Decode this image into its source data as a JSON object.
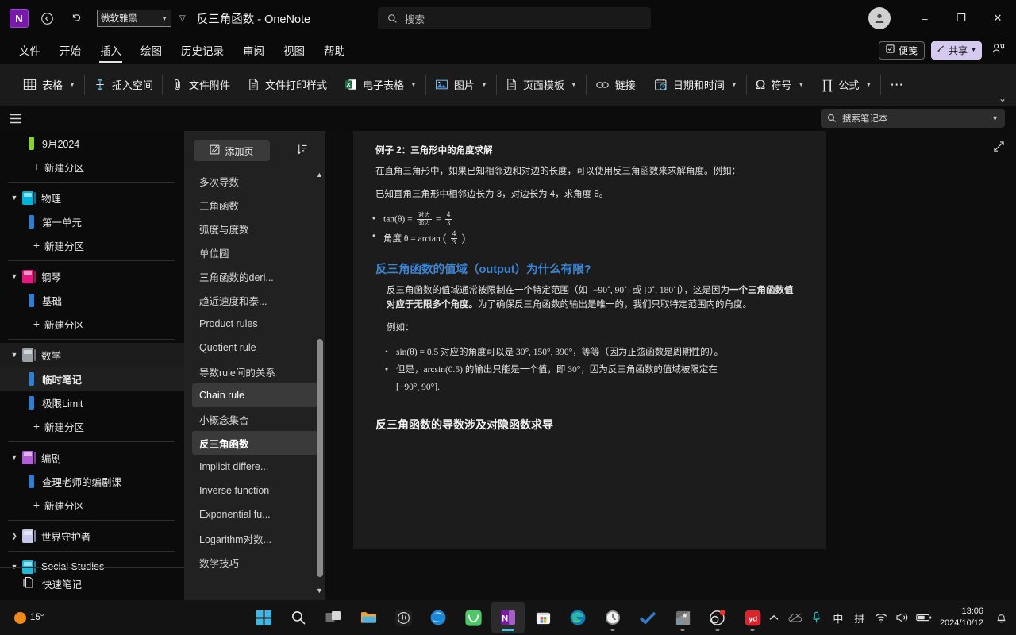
{
  "titlebar": {
    "app_logo": "N",
    "back_icon": "back-arrow-icon",
    "undo_icon": "undo-icon",
    "font_name": "微软雅黑",
    "doc_title": "反三角函数 - OneNote",
    "search_placeholder": "搜索",
    "minimize": "–",
    "maximize": "❐",
    "close": "✕"
  },
  "menu": {
    "items": [
      {
        "label": "文件",
        "active": false
      },
      {
        "label": "开始",
        "active": false
      },
      {
        "label": "插入",
        "active": true
      },
      {
        "label": "绘图",
        "active": false
      },
      {
        "label": "历史记录",
        "active": false
      },
      {
        "label": "审阅",
        "active": false
      },
      {
        "label": "视图",
        "active": false
      },
      {
        "label": "帮助",
        "active": false
      }
    ],
    "sticky_notes": "便笺",
    "share": "共享"
  },
  "ribbon": {
    "groups": [
      {
        "label": "表格",
        "icon": "table-icon",
        "dropdown": true
      },
      {
        "label": "插入空间",
        "icon": "insert-space-icon",
        "dropdown": false
      },
      {
        "label": "文件附件",
        "icon": "paperclip-icon",
        "dropdown": false
      },
      {
        "label": "文件打印样式",
        "icon": "printout-icon",
        "dropdown": false
      },
      {
        "label": "电子表格",
        "icon": "excel-icon",
        "dropdown": true
      },
      {
        "label": "图片",
        "icon": "picture-icon",
        "dropdown": true
      },
      {
        "label": "页面模板",
        "icon": "page-template-icon",
        "dropdown": true
      },
      {
        "label": "链接",
        "icon": "link-icon",
        "dropdown": false
      },
      {
        "label": "日期和时间",
        "icon": "calendar-clock-icon",
        "dropdown": true
      },
      {
        "label": "符号",
        "icon": "omega-icon",
        "dropdown": true
      },
      {
        "label": "公式",
        "icon": "pi-icon",
        "dropdown": true
      }
    ],
    "overflow": "⋯",
    "collapse": "⌄"
  },
  "notebookbar": {
    "menu_icon": "hamburger-icon",
    "search_placeholder": "搜索笔记本"
  },
  "leftnav": {
    "items": [
      {
        "type": "section",
        "label": "9月2024",
        "color": "#8bd02b"
      },
      {
        "type": "new",
        "label": "新建分区"
      },
      {
        "type": "divider"
      },
      {
        "type": "notebook",
        "label": "物理",
        "color": "#00b3d8",
        "expanded": true
      },
      {
        "type": "section",
        "label": "第一单元",
        "color": "#2f7fd1"
      },
      {
        "type": "new",
        "label": "新建分区"
      },
      {
        "type": "divider"
      },
      {
        "type": "notebook",
        "label": "钢琴",
        "color": "#e6187f",
        "expanded": true
      },
      {
        "type": "section",
        "label": "基础",
        "color": "#2f7fd1"
      },
      {
        "type": "new",
        "label": "新建分区"
      },
      {
        "type": "divider"
      },
      {
        "type": "notebook",
        "label": "数学",
        "color": "#9aa0a6",
        "expanded": true,
        "selected": true
      },
      {
        "type": "section",
        "label": "临时笔记",
        "color": "#2f7fd1",
        "current": true
      },
      {
        "type": "section",
        "label": "极限Limit",
        "color": "#2f7fd1"
      },
      {
        "type": "new",
        "label": "新建分区"
      },
      {
        "type": "divider"
      },
      {
        "type": "notebook",
        "label": "编剧",
        "color": "#b35fd6",
        "expanded": true
      },
      {
        "type": "section",
        "label": "查理老师的编剧课",
        "color": "#2f7fd1"
      },
      {
        "type": "new",
        "label": "新建分区"
      },
      {
        "type": "divider"
      },
      {
        "type": "notebook",
        "label": "世界守护者",
        "color": "#c5c8e8",
        "expanded": false
      },
      {
        "type": "divider"
      },
      {
        "type": "notebook",
        "label": "Social Studies",
        "color": "#22b8d6",
        "expanded": true
      }
    ],
    "quick_notes": "快速笔记"
  },
  "pagelist": {
    "add_page": "添加页",
    "add_page_icon": "new-page-icon",
    "sort_icon": "sort-icon",
    "pages": [
      {
        "label": "多次导数"
      },
      {
        "label": "三角函数"
      },
      {
        "label": "弧度与度数"
      },
      {
        "label": "单位圆"
      },
      {
        "label": "三角函数的deri..."
      },
      {
        "label": "趋近速度和泰..."
      },
      {
        "label": "Product rules"
      },
      {
        "label": "Quotient rule"
      },
      {
        "label": "导数rule间的关系"
      },
      {
        "label": "Chain rule",
        "hover": true
      },
      {
        "label": "小概念集合"
      },
      {
        "label": "反三角函数",
        "current": true
      },
      {
        "label": "Implicit differe..."
      },
      {
        "label": "Inverse function"
      },
      {
        "label": "Exponential fu..."
      },
      {
        "label": "Logarithm对数..."
      },
      {
        "label": "数学技巧"
      }
    ],
    "nav_toggle_icon": "page-nav-toggle-icon",
    "nav_toggle_label": "+"
  },
  "canvas": {
    "expand_icon": "expand-icon",
    "example_title": "例子 2：三角形中的角度求解",
    "para1": "在直角三角形中，如果已知相邻边和对边的长度，可以使用反三角函数来求解角度。例如：",
    "para2": "已知直角三角形中相邻边长为 3，对边长为 4，求角度 θ。",
    "bullet1_prefix": "tan(θ) =",
    "bullet1_frac1_num": "对边",
    "bullet1_frac1_den": "邻边",
    "bullet1_eq": "=",
    "bullet1_frac2_num": "4",
    "bullet1_frac2_den": "3",
    "bullet2_prefix": "角度 θ = arctan",
    "bullet2_frac_num": "4",
    "bullet2_frac_den": "3",
    "heading_blue": "反三角函数的值域（output）为什么有限?",
    "para3_a": "反三角函数的值域通常被限制在一个特定范围（如 ",
    "para3_range1": "[−90˚, 90˚]",
    "para3_b": " 或 ",
    "para3_range2": "[0˚, 180˚]",
    "para3_c": "），这是因为",
    "para3_bold": "一个三角函数值对应于无限多个角度。",
    "para3_d": "为了确保反三角函数的输出是唯一的，我们只取特定范围内的角度。",
    "para4": "例如：",
    "bullet3": "sin(θ) = 0.5 对应的角度可以是 30°, 150°, 390°，等等（因为正弦函数是周期性的）。",
    "bullet4_a": "但是，arcsin(0.5) 的输出只能是一个值，即 30°，因为反三角函数的值域被限定在",
    "bullet4_b": "[−90°, 90°].",
    "heading_white": "反三角函数的导数涉及对隐函数求导"
  },
  "taskbar": {
    "weather_temp": "15°",
    "weather_icon": "sun-cloud-icon",
    "buttons": [
      {
        "name": "start-button",
        "icon": "windows-logo-icon"
      },
      {
        "name": "search-button",
        "icon": "search-icon"
      },
      {
        "name": "task-view-button",
        "icon": "task-view-icon"
      },
      {
        "name": "file-explorer-button",
        "icon": "folder-icon"
      },
      {
        "name": "app-unreal-button",
        "icon": "unreal-icon"
      },
      {
        "name": "app-browser-button",
        "icon": "browser-icon"
      },
      {
        "name": "app-chat-button",
        "icon": "green-chat-icon"
      },
      {
        "name": "onenote-button",
        "icon": "onenote-icon",
        "active": true
      },
      {
        "name": "microsoft-store-button",
        "icon": "store-icon"
      },
      {
        "name": "edge-button",
        "icon": "edge-icon"
      },
      {
        "name": "clock-app-button",
        "icon": "clock-icon"
      },
      {
        "name": "todo-button",
        "icon": "checkmark-icon"
      },
      {
        "name": "snipping-tool-button",
        "icon": "snip-icon"
      },
      {
        "name": "obs-button",
        "icon": "obs-icon"
      },
      {
        "name": "youdao-button",
        "icon": "yd-icon"
      }
    ],
    "tray": [
      {
        "name": "show-hidden-icons",
        "glyph": "⌃"
      },
      {
        "name": "onedrive-icon",
        "glyph": "☁"
      },
      {
        "name": "microphone-icon",
        "glyph": "🎙"
      },
      {
        "name": "ime-mode-icon",
        "glyph": "中"
      },
      {
        "name": "ime-pinyin-icon",
        "glyph": "拼"
      },
      {
        "name": "wifi-icon",
        "glyph": "📶"
      },
      {
        "name": "volume-icon",
        "glyph": "🔊"
      },
      {
        "name": "battery-icon",
        "glyph": "🔋"
      }
    ],
    "time": "13:06",
    "date": "2024/10/12",
    "notification_icon": "bell-icon"
  }
}
